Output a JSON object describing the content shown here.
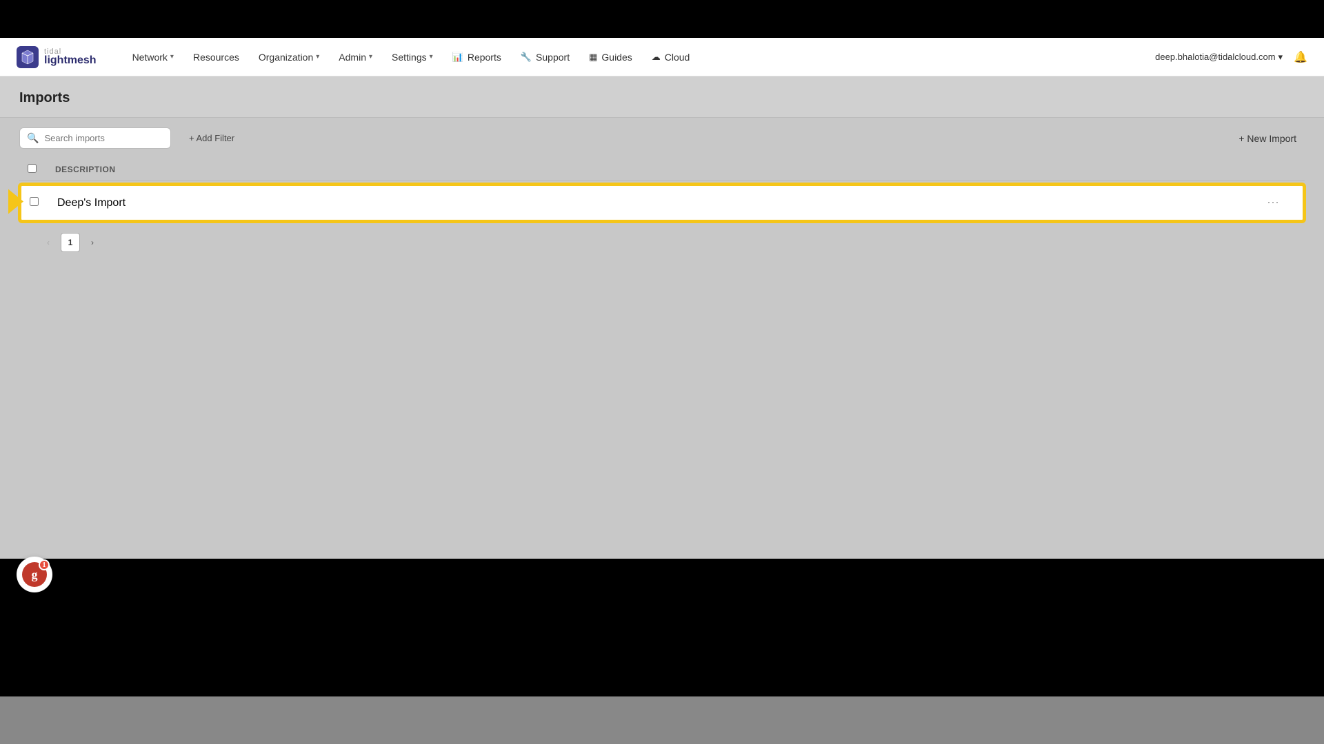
{
  "blackBars": {
    "topHeight": 55,
    "bottomHeight": 200
  },
  "navbar": {
    "logo": {
      "brand": "tidal",
      "product": "lightmesh"
    },
    "nav_items": [
      {
        "label": "Network",
        "hasDropdown": true
      },
      {
        "label": "Resources",
        "hasDropdown": false
      },
      {
        "label": "Organization",
        "hasDropdown": true
      },
      {
        "label": "Admin",
        "hasDropdown": true
      },
      {
        "label": "Settings",
        "hasDropdown": true
      },
      {
        "label": "Reports",
        "hasIcon": true,
        "iconType": "bar-chart"
      },
      {
        "label": "Support",
        "hasIcon": true,
        "iconType": "wrench"
      },
      {
        "label": "Guides",
        "hasIcon": true,
        "iconType": "grid"
      },
      {
        "label": "Cloud",
        "hasIcon": true,
        "iconType": "cloud"
      }
    ],
    "user_email": "deep.bhalotia@tidalcloud.com",
    "user_has_dropdown": true,
    "bell_label": "notifications"
  },
  "page": {
    "title": "Imports",
    "search_placeholder": "Search imports",
    "add_filter_label": "+ Add Filter",
    "new_import_label": "+ New Import"
  },
  "table": {
    "columns": [
      {
        "key": "select",
        "label": ""
      },
      {
        "key": "description",
        "label": "Description"
      },
      {
        "key": "actions",
        "label": ""
      }
    ],
    "rows": [
      {
        "id": 1,
        "name": "Deep's Import"
      }
    ]
  },
  "pagination": {
    "prev_label": "‹",
    "next_label": "›",
    "current_page": 1,
    "pages": [
      1
    ]
  },
  "g2badge": {
    "letter": "g",
    "notification_count": "1"
  }
}
